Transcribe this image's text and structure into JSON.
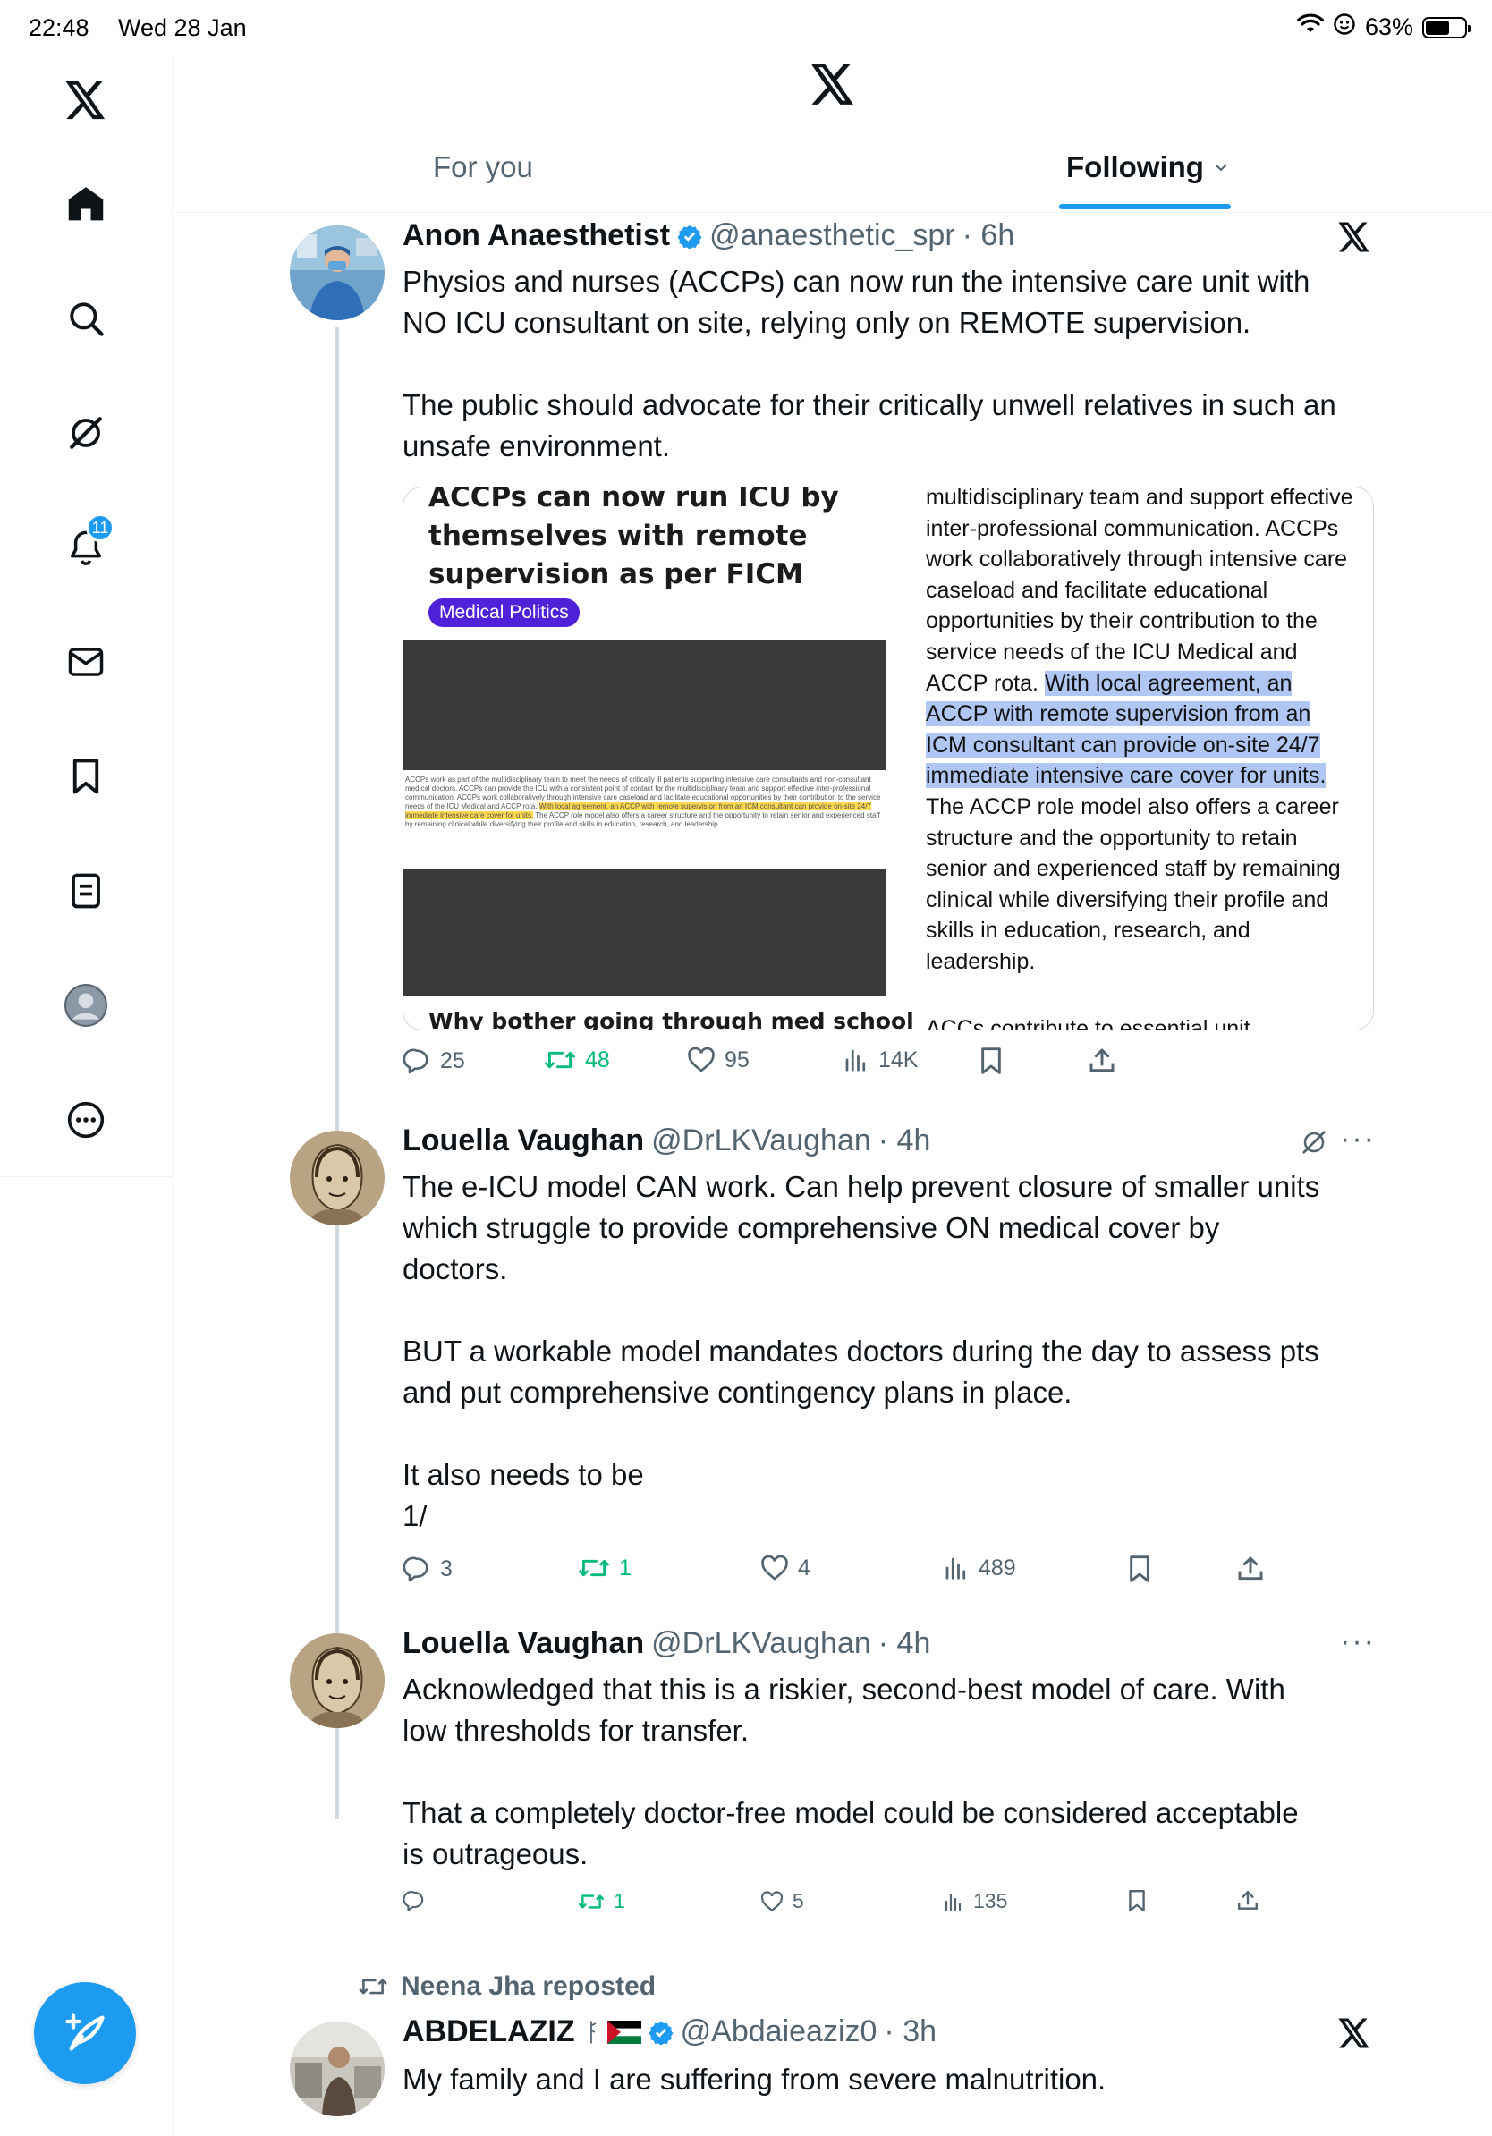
{
  "status_bar": {
    "time": "22:48",
    "date": "Wed 28 Jan",
    "battery": "63%"
  },
  "header": {
    "tabs": [
      {
        "label": "For you"
      },
      {
        "label": "Following"
      }
    ]
  },
  "nav": {
    "notifications_badge": "11"
  },
  "tweets": [
    {
      "name": "Anon Anaesthetist",
      "handle": "@anaesthetic_spr",
      "time": "· 6h",
      "text": "Physios and nurses (ACCPs) can now run the intensive care unit with\nNO ICU consultant on site, relying only on REMOTE supervision.\n\nThe public should advocate for their critically unwell relatives in such an\nunsafe environment.",
      "card": {
        "title": "ACCPs can now run ICU by themselves with remote supervision as per FICM",
        "tag": "Medical Politics",
        "tiny_text_a": "ACCPs work as part of the multidisciplinary team to meet the needs of critically ill patients supporting intensive care consultants and non-consultant medical doctors. ACCPs can provide the ICU with a consistent point of contact for the multidisciplinary team and support effective inter-professional communication. ACCPs work collaboratively through intensive care caseload and facilitate educational opportunities by their contribution to the service needs of the ICU Medical and ACCP rota.",
        "tiny_text_hl": "With local agreement, an ACCP with remote supervision from an ICM consultant can provide on-site 24/7 immediate intensive care cover for units.",
        "tiny_text_b": "The ACCP role model also offers a career structure and the opportunity to retain senior and experienced staff by remaining clinical while diversifying their profile and skills in education, research, and leadership.",
        "bottom_title": "Why bother going through med school",
        "right_text_a": "multidisciplinary team and support effective inter-professional communication. ACCPs work collaboratively through intensive care caseload and facilitate educational opportunities by their contribution to the service needs of the ICU Medical and ACCP rota. ",
        "right_text_hl": "With local agreement, an ACCP with remote supervision from an ICM consultant can provide on-site 24/7 immediate intensive care cover for units.",
        "right_text_b": " The ACCP role model also offers a career structure and the opportunity to retain senior and experienced staff by remaining clinical while diversifying their profile and skills in education, research, and leadership.",
        "right_text_cut": "ACCs contribute to essential unit"
      },
      "replies": "25",
      "reposts": "48",
      "likes": "95",
      "views": "14K"
    },
    {
      "name": "Louella Vaughan",
      "handle": "@DrLKVaughan",
      "time": "· 4h",
      "text": "The e-ICU model CAN work. Can help prevent closure of smaller units\nwhich struggle to provide comprehensive ON medical cover by\ndoctors.\n\nBUT a workable model mandates doctors during the day to assess pts\nand put comprehensive contingency plans in place.\n\nIt also needs to be\n1/",
      "replies": "3",
      "reposts": "1",
      "likes": "4",
      "views": "489"
    },
    {
      "name": "Louella Vaughan",
      "handle": "@DrLKVaughan",
      "time": "· 4h",
      "text": "Acknowledged that this is a riskier, second-best model of care. With\nlow thresholds for transfer.\n\nThat a completely doctor-free model could be considered acceptable\nis outrageous.",
      "replies": "",
      "reposts": "1",
      "likes": "5",
      "views": "135"
    },
    {
      "repost_label": "Neena Jha reposted",
      "name": "ABDELAZIZ",
      "handle": "@Abdaieaziz0",
      "time": "· 3h",
      "text": "My family and I are suffering from severe malnutrition."
    }
  ]
}
